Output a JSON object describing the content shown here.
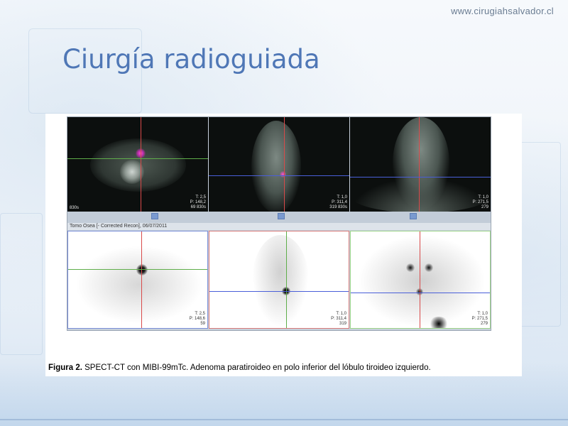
{
  "header": {
    "site_url": "www.cirugiahsalvador.cl",
    "title": "Ciurgía radioguiada"
  },
  "figure": {
    "caption_label": "Figura 2.",
    "caption_text": "SPECT-CT con MIBI-99mTc. Adenoma paratiroideo en polo inferior del lóbulo tiroideo izquierdo.",
    "status_bar": "Tomo Osea [- Corrected Recon], 06/07/2011",
    "ct_panels": [
      {
        "view": "axial",
        "corner_left": "830s",
        "readout_1": "T: 2,5",
        "readout_2": "P: 148,2",
        "readout_3": "69 830s"
      },
      {
        "view": "sagittal",
        "corner_left": "",
        "readout_1": "T: 1,0",
        "readout_2": "P: 311,4",
        "readout_3": "319 830s"
      },
      {
        "view": "coronal",
        "corner_left": "",
        "readout_1": "T: 1,0",
        "readout_2": "P: 271,5",
        "readout_3": "279"
      }
    ],
    "spect_panels": [
      {
        "view": "axial",
        "readout_1": "T: 2,5",
        "readout_2": "P: 148,6",
        "readout_3": "59"
      },
      {
        "view": "sagittal",
        "readout_1": "T: 1,0",
        "readout_2": "P: 311,4",
        "readout_3": "319"
      },
      {
        "view": "coronal",
        "readout_1": "T: 1,0",
        "readout_2": "P: 271,5",
        "readout_3": "279"
      }
    ],
    "crosshair_colors": {
      "vertical": "#d94a4a",
      "horizontal_ct_axial": "#5fae4a",
      "horizontal_ct_other": "#4a5fd9",
      "frame_axial": "#7b8fd8",
      "frame_sagittal": "#d97b7b",
      "frame_coronal": "#9fd58a"
    }
  }
}
